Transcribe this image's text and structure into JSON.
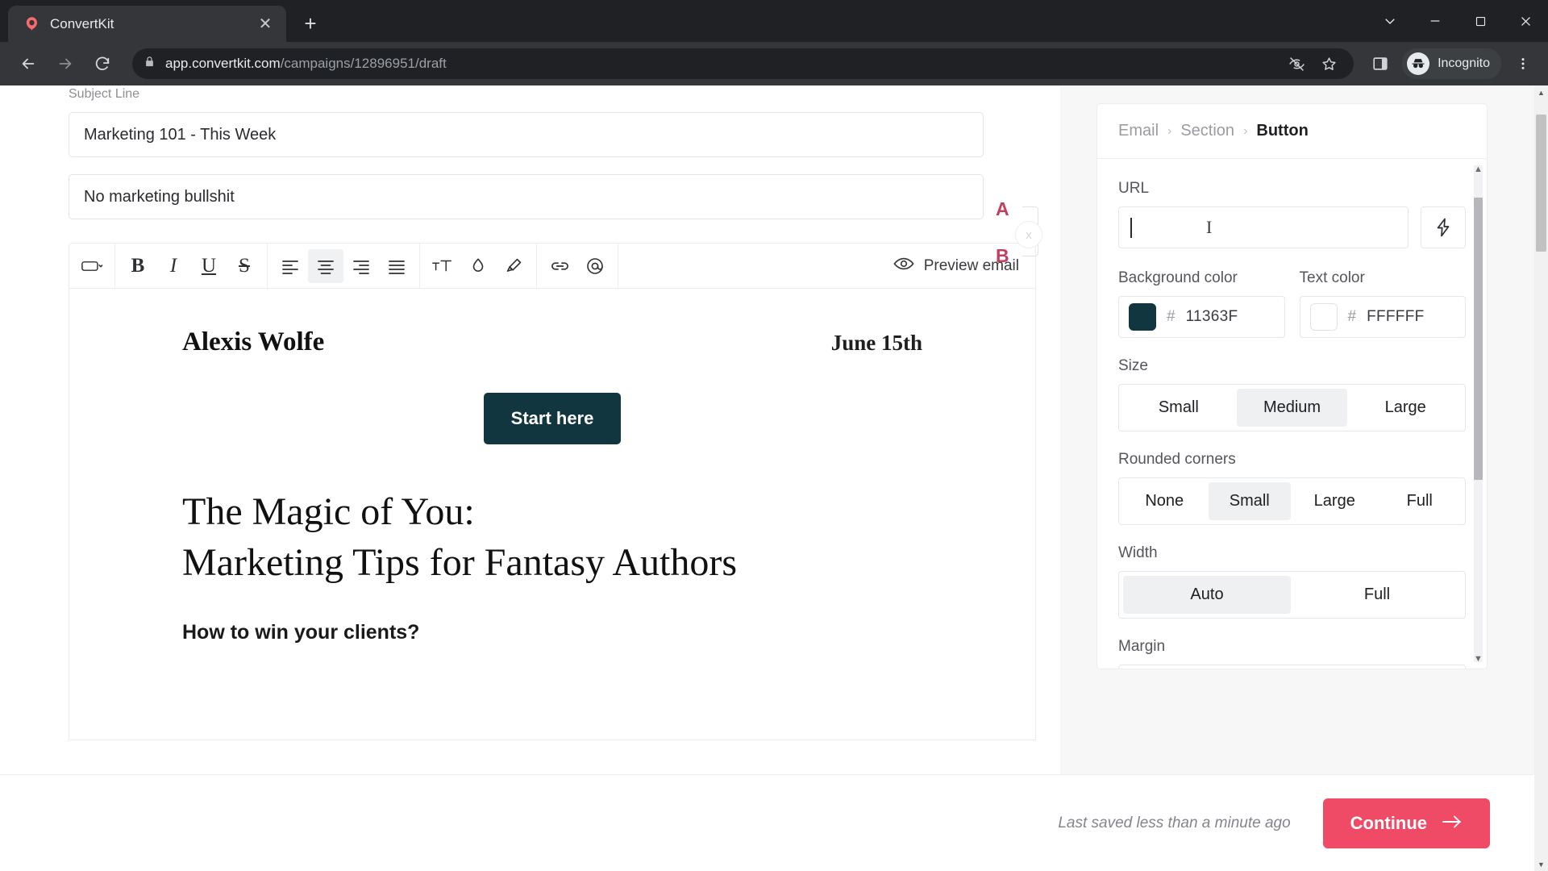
{
  "browser": {
    "tab": {
      "title": "ConvertKit",
      "favicon_icon": "convertkit-logo-icon",
      "close_icon": "close-icon"
    },
    "new_tab_icon": "plus-icon",
    "window_controls": [
      {
        "name": "chevron-down-icon",
        "glyph": "⌄"
      },
      {
        "name": "minimize-icon",
        "glyph": "─"
      },
      {
        "name": "maximize-icon",
        "glyph": "☐"
      },
      {
        "name": "window-close-icon",
        "glyph": "✕"
      }
    ],
    "nav": {
      "back_icon": "back-arrow-icon",
      "forward_icon": "forward-arrow-icon",
      "reload_icon": "reload-icon"
    },
    "address": {
      "lock_icon": "lock-icon",
      "host": "app.convertkit.com",
      "path": "/campaigns/12896951/draft"
    },
    "address_icons": [
      {
        "name": "third-party-cookie-blocked-icon"
      },
      {
        "name": "bookmark-star-icon"
      }
    ],
    "side_panel_icon": "side-panel-icon",
    "incognito": {
      "label": "Incognito",
      "icon": "incognito-avatar-icon"
    },
    "menu_icon": "kebab-menu-icon"
  },
  "editor": {
    "subject_label": "Subject Line",
    "subject_a": "Marketing 101 - This Week",
    "subject_b": "No marketing bullshit",
    "ab_test": {
      "a_label": "A",
      "b_label": "B",
      "remove_label": "x"
    },
    "toolbar": {
      "block_type_icon": "button-block-icon",
      "block_type_caret_icon": "chevron-down-icon",
      "bold_label": "B",
      "italic_label": "I",
      "underline_label": "U",
      "strikethrough_label": "S",
      "align_left_icon": "align-left-icon",
      "align_center_icon": "align-center-icon",
      "align_right_icon": "align-right-icon",
      "align_justify_icon": "align-justify-icon",
      "text_size_label": "тT",
      "text_color_icon": "droplet-icon",
      "highlight_icon": "highlighter-icon",
      "link_icon": "link-icon",
      "mention_icon": "at-mention-icon",
      "preview_label": "Preview email",
      "preview_icon": "eye-icon"
    },
    "email": {
      "author": "Alexis Wolfe",
      "date": "June 15th",
      "cta_button": "Start here",
      "headline_line1": "The Magic of You:",
      "headline_line2": "Marketing Tips for Fantasy Authors",
      "subheading": "How to win your clients?"
    }
  },
  "settings_panel": {
    "breadcrumb": [
      {
        "label": "Email",
        "current": false
      },
      {
        "label": "Section",
        "current": false
      },
      {
        "label": "Button",
        "current": true
      }
    ],
    "breadcrumb_separator": "›",
    "url": {
      "label": "URL",
      "value": "",
      "placeholder": ""
    },
    "personalize_icon": "lightning-bolt-icon",
    "background_color": {
      "label": "Background color",
      "hash": "#",
      "hex": "11363F",
      "swatch_hex": "#11363F"
    },
    "text_color": {
      "label": "Text color",
      "hash": "#",
      "hex": "FFFFFF",
      "swatch_hex": "#FFFFFF"
    },
    "size": {
      "label": "Size",
      "options": [
        "Small",
        "Medium",
        "Large"
      ],
      "selected": "Medium"
    },
    "rounded_corners": {
      "label": "Rounded corners",
      "options": [
        "None",
        "Small",
        "Large",
        "Full"
      ],
      "selected": "Small"
    },
    "width": {
      "label": "Width",
      "options": [
        "Auto",
        "Full"
      ],
      "selected": "Auto"
    },
    "margin": {
      "label": "Margin"
    },
    "scroll_up_icon": "scroll-up-arrow-icon",
    "scroll_down_icon": "scroll-down-arrow-icon"
  },
  "bottom_bar": {
    "saved_text": "Last saved less than a minute ago",
    "continue_label": "Continue",
    "continue_icon": "arrow-right-icon"
  },
  "colors": {
    "brand_pink": "#ef4b66",
    "button_navy": "#11363F",
    "chrome_dark": "#202124",
    "ab_marker": "#c2405f"
  }
}
